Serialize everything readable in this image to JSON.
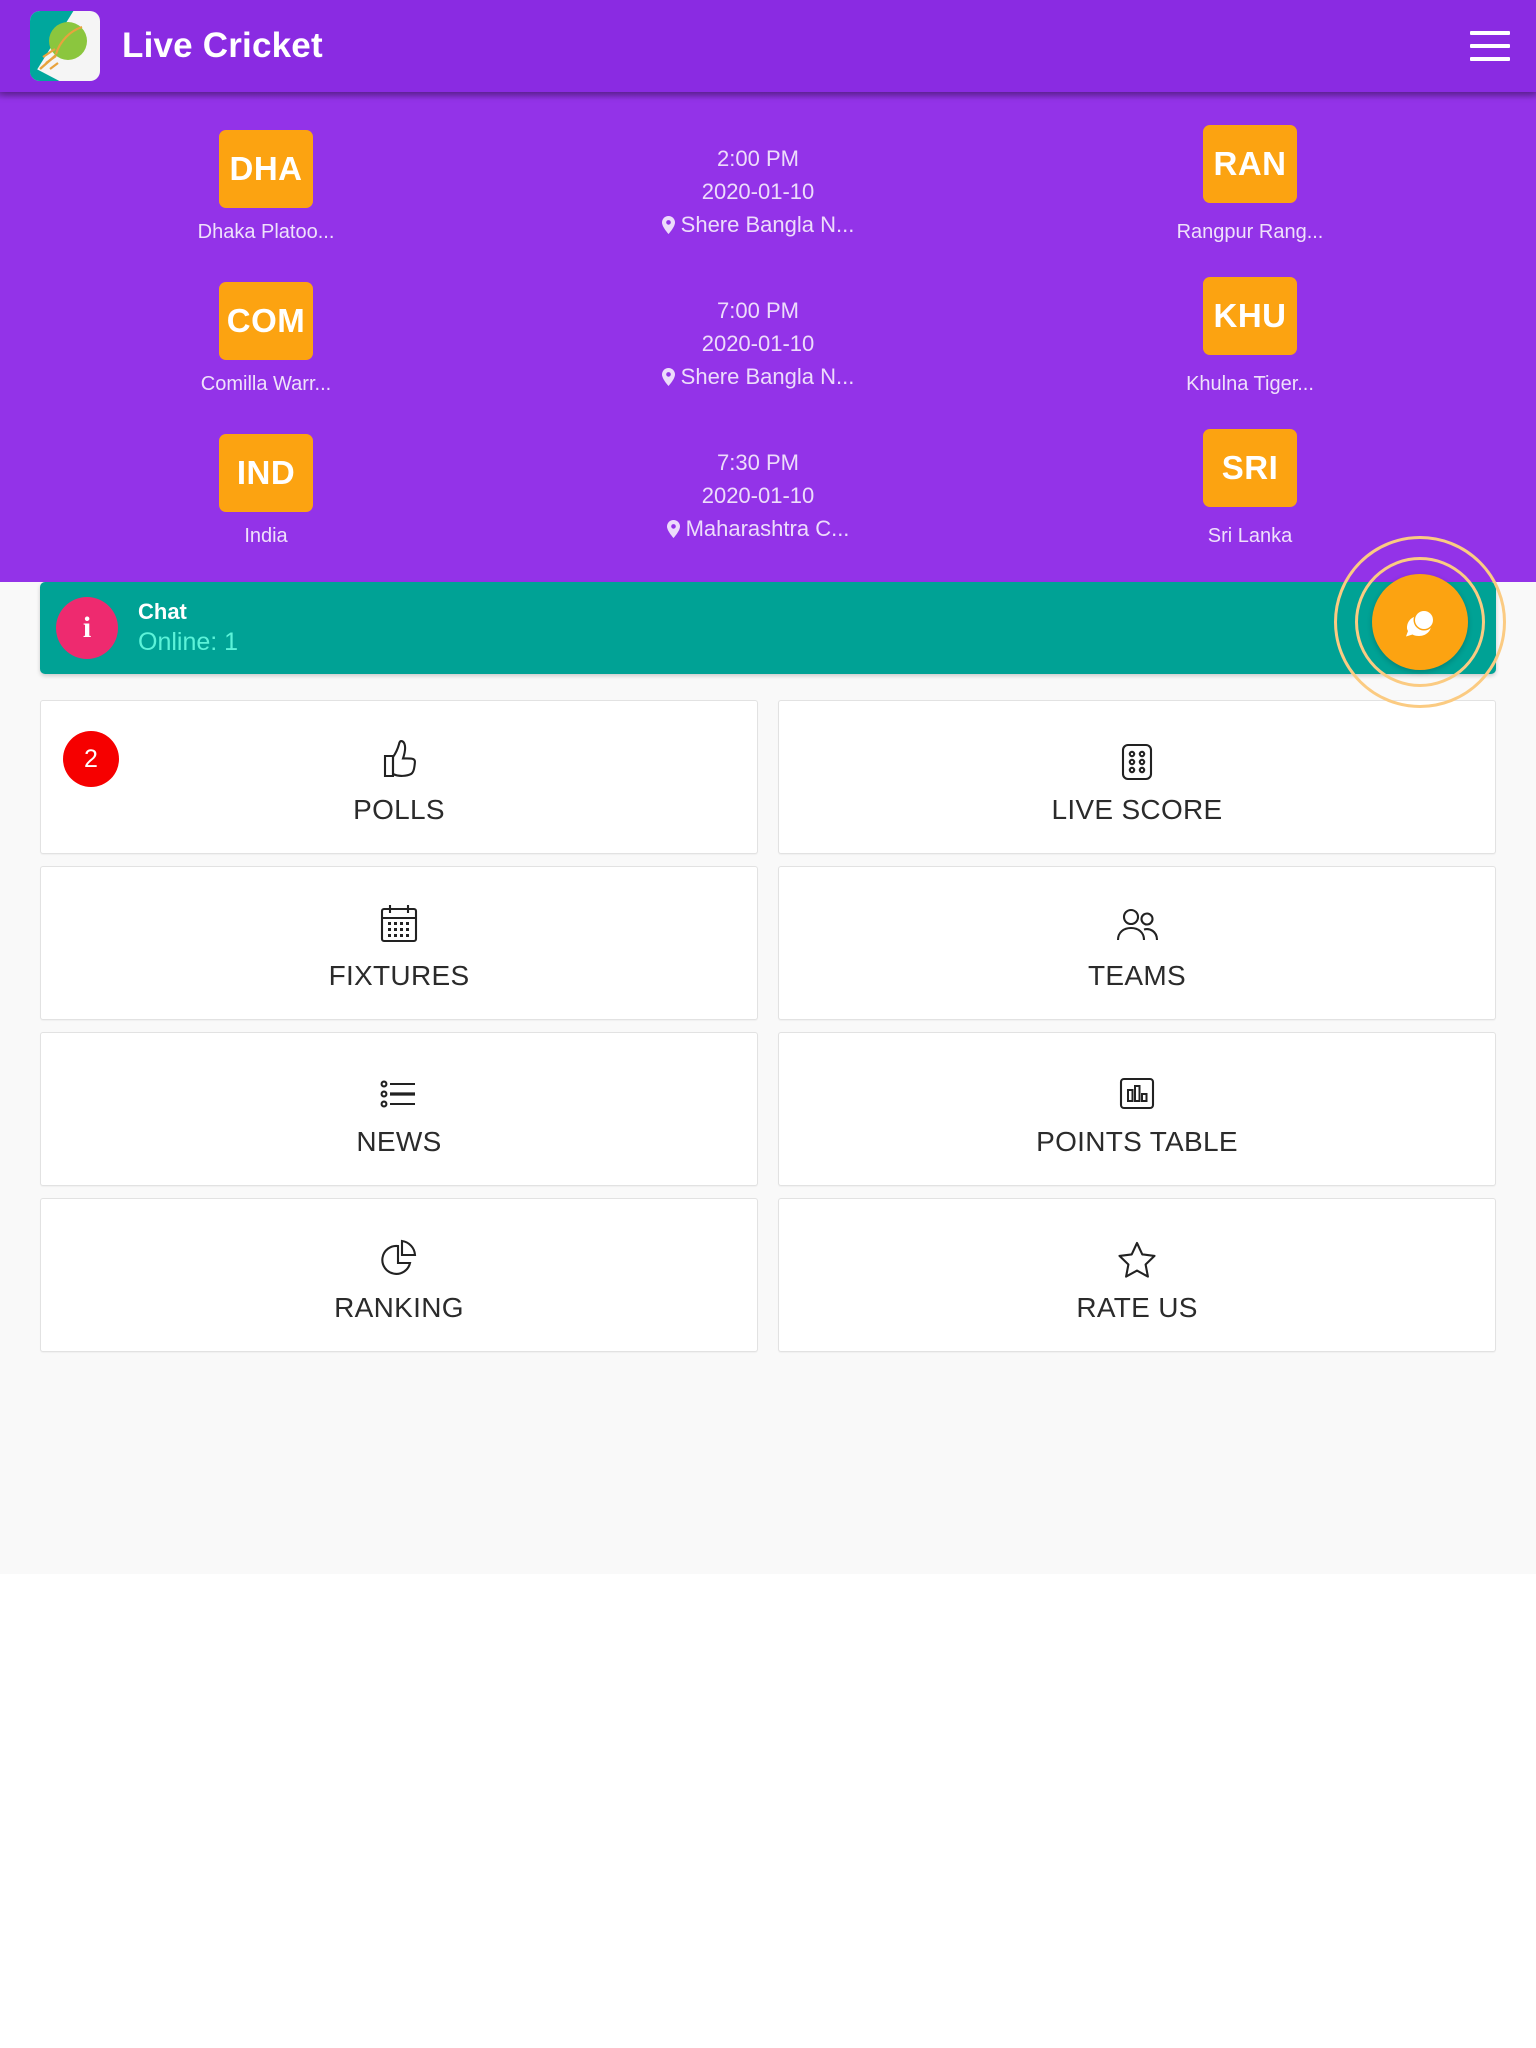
{
  "header": {
    "title": "Live Cricket",
    "logo_icon": "cricket-ball-logo",
    "menu_icon": "hamburger-menu-icon",
    "background_color": "#8A2BE2"
  },
  "matches": {
    "background_color": "#9333E8",
    "badge_color": "#FCA311",
    "items": [
      {
        "home_short": "DHA",
        "home_name": "Dhaka Platoo...",
        "time": "2:00 PM",
        "date": "2020-01-10",
        "venue": "Shere Bangla N...",
        "venue_icon": "location-pin-icon",
        "away_short": "RAN",
        "away_name": "Rangpur Rang..."
      },
      {
        "home_short": "COM",
        "home_name": "Comilla Warr...",
        "time": "7:00 PM",
        "date": "2020-01-10",
        "venue": "Shere Bangla N...",
        "venue_icon": "location-pin-icon",
        "away_short": "KHU",
        "away_name": "Khulna Tiger..."
      },
      {
        "home_short": "IND",
        "home_name": "India",
        "time": "7:30 PM",
        "date": "2020-01-10",
        "venue": "Maharashtra C...",
        "venue_icon": "location-pin-icon",
        "away_short": "SRI",
        "away_name": "Sri Lanka"
      }
    ]
  },
  "chat_bar": {
    "info_icon": "info-icon",
    "title": "Chat",
    "online": "Online: 1",
    "background_color": "#00A295",
    "info_dot_color": "#EE2A6F",
    "online_text_color": "#5CF3D9",
    "fab_icon": "chat-bubble-icon",
    "fab_color": "#FCA311"
  },
  "menu_grid": {
    "tiles": [
      {
        "label": "POLLS",
        "icon": "thumbs-up-icon",
        "badge": "2"
      },
      {
        "label": "LIVE SCORE",
        "icon": "dice-dots-icon",
        "badge": null
      },
      {
        "label": "FIXTURES",
        "icon": "calendar-icon",
        "badge": null
      },
      {
        "label": "TEAMS",
        "icon": "people-icon",
        "badge": null
      },
      {
        "label": "NEWS",
        "icon": "bullet-list-icon",
        "badge": null
      },
      {
        "label": "POINTS TABLE",
        "icon": "bar-chart-icon",
        "badge": null
      },
      {
        "label": "RANKING",
        "icon": "pie-chart-icon",
        "badge": null
      },
      {
        "label": "RATE US",
        "icon": "star-icon",
        "badge": null
      }
    ],
    "badge_color": "#F60000"
  }
}
